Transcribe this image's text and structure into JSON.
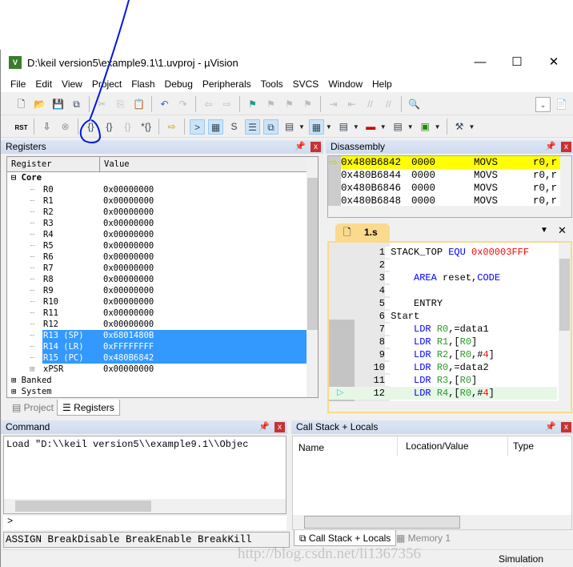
{
  "window": {
    "title": "D:\\keil version5\\example9.1\\1.uvproj - µVision",
    "minimize": "—",
    "maximize": "☐",
    "close": "✕"
  },
  "menu": [
    "File",
    "Edit",
    "View",
    "Project",
    "Flash",
    "Debug",
    "Peripherals",
    "Tools",
    "SVCS",
    "Window",
    "Help"
  ],
  "toolbar2": {
    "reset_label": "RST"
  },
  "registers": {
    "title": "Registers",
    "col_register": "Register",
    "col_value": "Value",
    "core": "Core",
    "rows": [
      {
        "name": "R0",
        "value": "0x00000000"
      },
      {
        "name": "R1",
        "value": "0x00000000"
      },
      {
        "name": "R2",
        "value": "0x00000000"
      },
      {
        "name": "R3",
        "value": "0x00000000"
      },
      {
        "name": "R4",
        "value": "0x00000000"
      },
      {
        "name": "R5",
        "value": "0x00000000"
      },
      {
        "name": "R6",
        "value": "0x00000000"
      },
      {
        "name": "R7",
        "value": "0x00000000"
      },
      {
        "name": "R8",
        "value": "0x00000000"
      },
      {
        "name": "R9",
        "value": "0x00000000"
      },
      {
        "name": "R10",
        "value": "0x00000000"
      },
      {
        "name": "R11",
        "value": "0x00000000"
      },
      {
        "name": "R12",
        "value": "0x00000000"
      },
      {
        "name": "R13 (SP)",
        "value": "0x6801480B",
        "selected": true
      },
      {
        "name": "R14 (LR)",
        "value": "0xFFFFFFFF",
        "selected": true
      },
      {
        "name": "R15 (PC)",
        "value": "0x480B6842",
        "selected": true
      },
      {
        "name": "xPSR",
        "value": "0x00000000"
      }
    ],
    "banked": "Banked",
    "system": "System",
    "tabs": [
      "Project",
      "Registers"
    ]
  },
  "disassembly": {
    "title": "Disassembly",
    "rows": [
      {
        "addr": "0x480B6842",
        "code": "0000",
        "op": "MOVS",
        "args": "r0,r",
        "current": true
      },
      {
        "addr": "0x480B6844",
        "code": "0000",
        "op": "MOVS",
        "args": "r0,r"
      },
      {
        "addr": "0x480B6846",
        "code": "0000",
        "op": "MOVS",
        "args": "r0,r"
      },
      {
        "addr": "0x480B6848",
        "code": "0000",
        "op": "MOVS",
        "args": "r0,r"
      }
    ]
  },
  "editor": {
    "tab": "1.s",
    "lines": [
      {
        "n": "1",
        "parts": [
          [
            "",
            "STACK_TOP "
          ],
          [
            "kw",
            "EQU "
          ],
          [
            "nm",
            "0x00003FFF"
          ]
        ]
      },
      {
        "n": "2",
        "parts": []
      },
      {
        "n": "3",
        "parts": [
          [
            "",
            "    "
          ],
          [
            "kw",
            "AREA"
          ],
          [
            "",
            " reset,"
          ],
          [
            "kw",
            "CODE"
          ]
        ]
      },
      {
        "n": "4",
        "parts": []
      },
      {
        "n": "5",
        "parts": [
          [
            "",
            "    ENTRY"
          ]
        ]
      },
      {
        "n": "6",
        "parts": [
          [
            "",
            "Start"
          ]
        ]
      },
      {
        "n": "7",
        "parts": [
          [
            "",
            "    "
          ],
          [
            "kw",
            "LDR "
          ],
          [
            "rg",
            "R0"
          ],
          [
            "",
            ",=data1"
          ]
        ]
      },
      {
        "n": "8",
        "parts": [
          [
            "",
            "    "
          ],
          [
            "kw",
            "LDR "
          ],
          [
            "rg",
            "R1"
          ],
          [
            "",
            ",["
          ],
          [
            "rg",
            "R0"
          ],
          [
            "",
            "]"
          ]
        ]
      },
      {
        "n": "9",
        "parts": [
          [
            "",
            "    "
          ],
          [
            "kw",
            "LDR "
          ],
          [
            "rg",
            "R2"
          ],
          [
            "",
            ",["
          ],
          [
            "rg",
            "R0"
          ],
          [
            "",
            ",#"
          ],
          [
            "nm",
            "4"
          ],
          [
            "",
            "]"
          ]
        ]
      },
      {
        "n": "10",
        "parts": [
          [
            "",
            "    "
          ],
          [
            "kw",
            "LDR "
          ],
          [
            "rg",
            "R0"
          ],
          [
            "",
            ",=data2"
          ]
        ]
      },
      {
        "n": "11",
        "parts": [
          [
            "",
            "    "
          ],
          [
            "kw",
            "LDR "
          ],
          [
            "rg",
            "R3"
          ],
          [
            "",
            ",["
          ],
          [
            "rg",
            "R0"
          ],
          [
            "",
            "]"
          ]
        ]
      },
      {
        "n": "12",
        "parts": [
          [
            "",
            "    "
          ],
          [
            "kw",
            "LDR "
          ],
          [
            "rg",
            "R4"
          ],
          [
            "",
            ",["
          ],
          [
            "rg",
            "R0"
          ],
          [
            "",
            ",#"
          ],
          [
            "nm",
            "4"
          ],
          [
            "",
            "]"
          ]
        ],
        "current": true
      }
    ]
  },
  "command": {
    "title": "Command",
    "output": "Load \"D:\\\\keil version5\\\\example9.1\\\\Objec",
    "prompt": ">",
    "hints": "ASSIGN BreakDisable BreakEnable BreakKill"
  },
  "callstack": {
    "title": "Call Stack + Locals",
    "columns": [
      "Name",
      "Location/Value",
      "Type"
    ],
    "tabs": [
      "Call Stack + Locals",
      "Memory 1"
    ]
  },
  "status": {
    "mode": "Simulation",
    "watermark": "http://blog.csdn.net/li1367356"
  },
  "colors": {
    "selection": "#3399ff",
    "current_line": "#ffff00",
    "annotation": "#0018e0"
  }
}
